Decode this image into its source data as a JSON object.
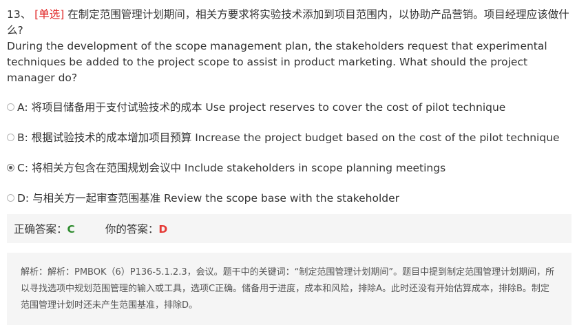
{
  "question": {
    "number": "13、",
    "type_label": "[单选]",
    "text_cn": "在制定范围管理计划期间，相关方要求将实验技术添加到项目范围内，以协助产品营销。项目经理应该做什么?",
    "text_en": "During the development of the scope management plan, the stakeholders request that experimental techniques be added to the project scope to assist in product marketing. What should the project manager do?"
  },
  "options": [
    {
      "label": "A: 将项目储备用于支付试验技术的成本 Use project reserves to cover the cost of pilot technique",
      "selected": false
    },
    {
      "label": "B: 根据试验技术的成本增加项目预算 Increase the project budget based on the cost of the pilot technique",
      "selected": false
    },
    {
      "label": "C: 将相关方包含在范围规划会议中 Include stakeholders in scope planning meetings",
      "selected": true
    },
    {
      "label": "D: 与相关方一起审查范围基准 Review the scope base with the stakeholder",
      "selected": false
    }
  ],
  "answers": {
    "correct_label": "正确答案：",
    "correct_value": "C",
    "yours_label": "你的答案：",
    "yours_value": "D",
    "correct_color": "#2e8b2e",
    "yours_color": "#e53935"
  },
  "analysis": {
    "text": "解析：解析：PMBOK（6）P136-5.1.2.3，会议。题干中的关键词：“制定范围管理计划期间”。题目中提到制定范围管理计划期间，所以寻找选项中规划范围管理的输入或工具，选项C正确。储备用于进度，成本和风险，排除A。此时还没有开始估算成本，排除B。制定范围管理计划时还未产生范围基准，排除D。"
  }
}
